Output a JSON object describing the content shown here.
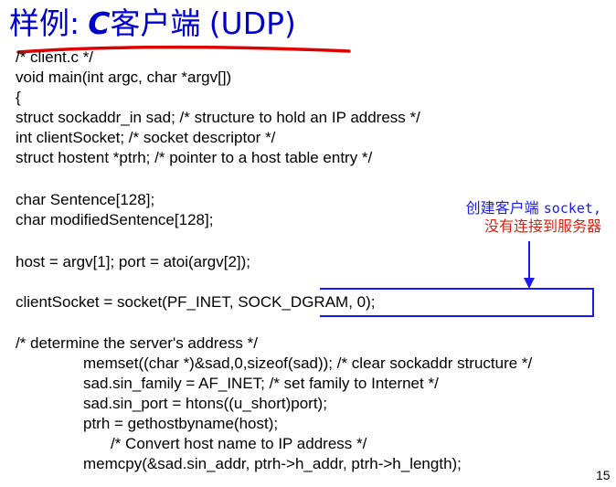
{
  "slide": {
    "title_cn1": "样例",
    "title_colon": ":",
    "title_c": "C",
    "title_cn2": "客户端",
    "title_udp": "(UDP)",
    "code_lines": {
      "l1": "/* client.c  */",
      "l2": "void main(int argc, char *argv[])",
      "l3": "{",
      "l4": "struct sockaddr_in sad; /* structure to hold an IP address */",
      "l5": "int clientSocket; /* socket descriptor */",
      "l6": "struct hostent *ptrh; /* pointer to a host table entry */",
      "l7": "char Sentence[128];",
      "l8": "char modifiedSentence[128];",
      "l9": "host = argv[1]; port = atoi(argv[2]);",
      "l10": "clientSocket = socket(PF_INET, SOCK_DGRAM, 0);",
      "l11": "/* determine the server's address */",
      "l12": "memset((char *)&sad,0,sizeof(sad)); /* clear sockaddr structure */",
      "l13": "sad.sin_family = AF_INET; /* set family to Internet */",
      "l14": "sad.sin_port = htons((u_short)port);",
      "l15": "ptrh = gethostbyname(host);",
      "l16": "/* Convert host name to IP address */",
      "l17": "memcpy(&sad.sin_addr, ptrh->h_addr, ptrh->h_length);"
    },
    "annotation": {
      "line1_cn": "创建客户端",
      "line1_en": "socket,",
      "line2": "没有连接到服务器"
    },
    "page_number": "15",
    "colors": {
      "title": "#0000cc",
      "title_underline": "#dd0000",
      "annotation_line1": "#1a1aee",
      "annotation_line2": "#dd2211",
      "callout": "#1a1aee"
    }
  }
}
